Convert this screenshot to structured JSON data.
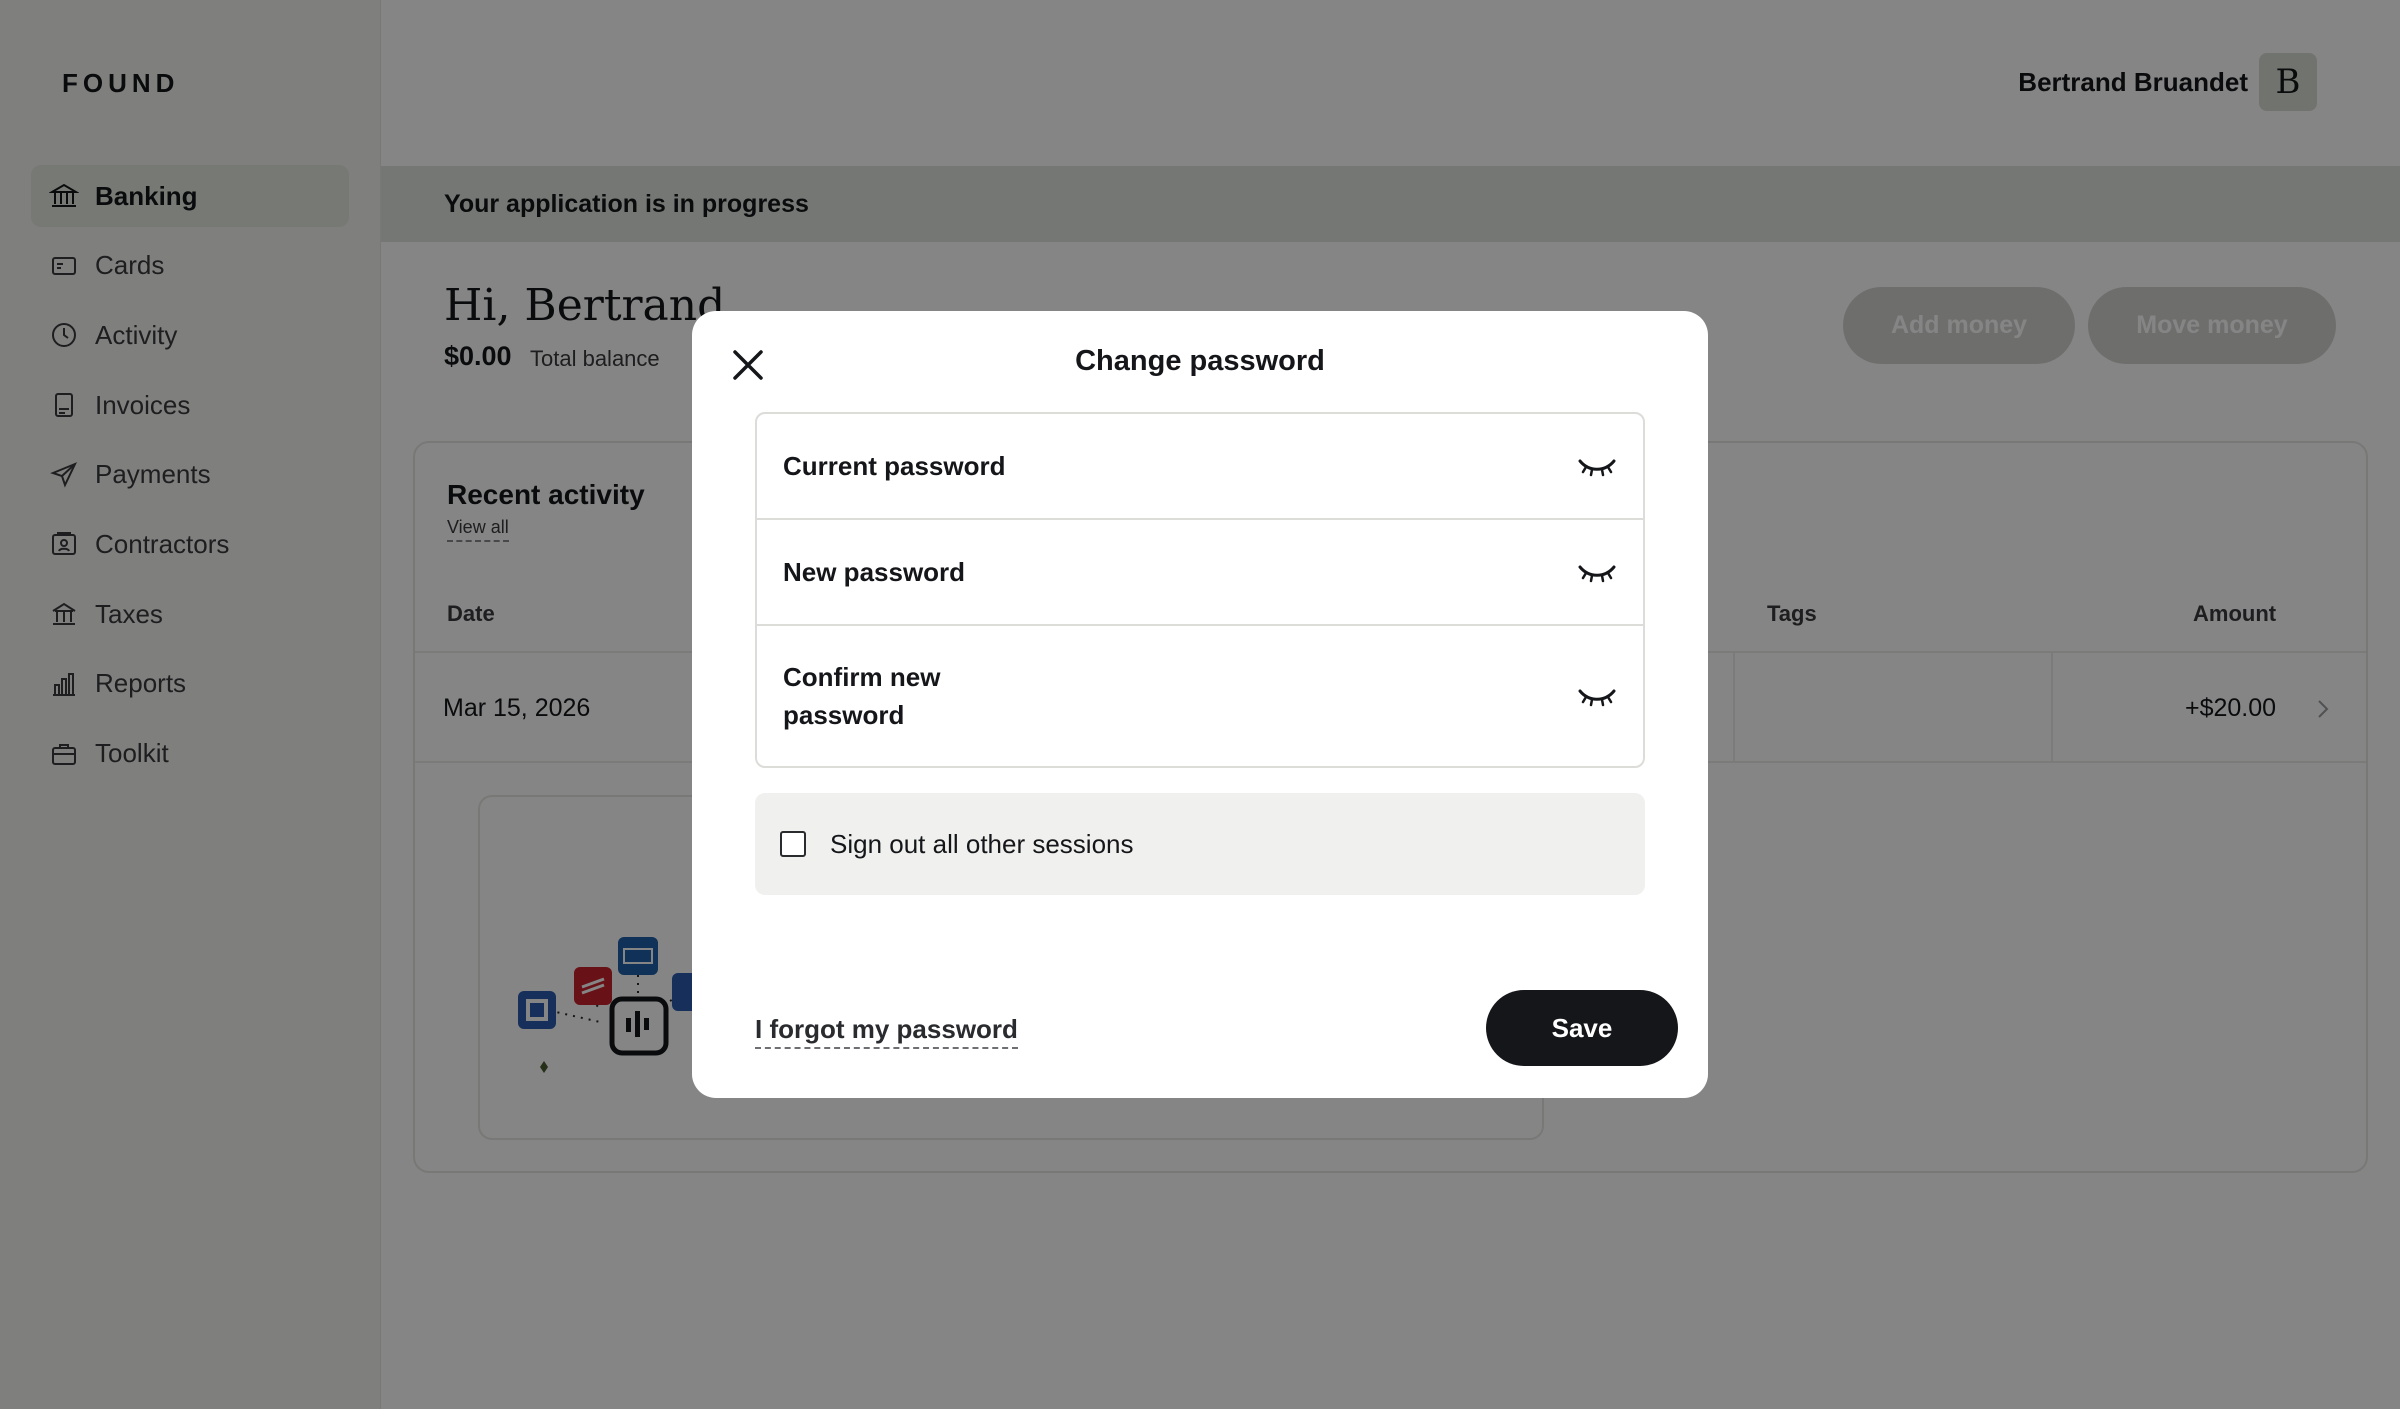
{
  "app": {
    "logo": "FOUND"
  },
  "user": {
    "name": "Bertrand Bruandet",
    "initial": "B"
  },
  "sidebar": {
    "items": [
      {
        "label": "Banking",
        "icon": "bank-icon",
        "active": true
      },
      {
        "label": "Cards",
        "icon": "card-icon"
      },
      {
        "label": "Activity",
        "icon": "clock-icon"
      },
      {
        "label": "Invoices",
        "icon": "invoice-icon"
      },
      {
        "label": "Payments",
        "icon": "send-icon"
      },
      {
        "label": "Contractors",
        "icon": "contractor-icon"
      },
      {
        "label": "Taxes",
        "icon": "government-icon"
      },
      {
        "label": "Reports",
        "icon": "bar-chart-icon"
      },
      {
        "label": "Toolkit",
        "icon": "briefcase-icon"
      }
    ]
  },
  "banner": {
    "text": "Your application is in progress"
  },
  "dashboard": {
    "greeting": "Hi, Bertrand",
    "balance": "$0.00",
    "balance_label": "Total balance",
    "add_money": "Add money",
    "move_money": "Move money"
  },
  "recent_activity": {
    "title": "Recent activity",
    "view_all": "View all",
    "columns": {
      "date": "Date",
      "tags": "Tags",
      "amount": "Amount"
    },
    "rows": [
      {
        "date": "Mar 15, 2026",
        "tags": "",
        "amount": "+$20.00"
      }
    ]
  },
  "modal": {
    "title": "Change password",
    "fields": {
      "current": "Current password",
      "new": "New password",
      "confirm": "Confirm new password"
    },
    "sign_out_label": "Sign out all other sessions",
    "sign_out_checked": false,
    "forgot": "I forgot my password",
    "save": "Save"
  },
  "colors": {
    "accent_dark": "#15161a",
    "active_nav": "#e4e8de",
    "banner": "#dfe4dc",
    "overlay": "rgba(0,0,0,0.48)"
  }
}
